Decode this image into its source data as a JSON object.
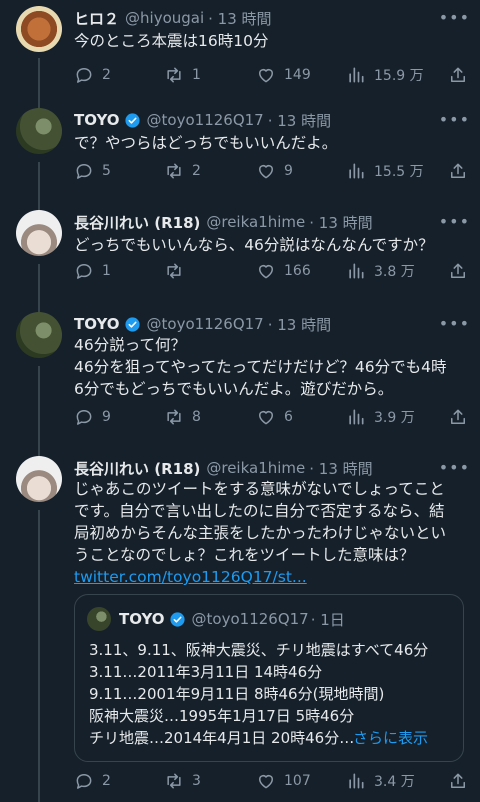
{
  "tweets": [
    {
      "name": "ヒロ２",
      "handle": "@hiyougai",
      "time": "· 13 時間",
      "text": "今のところ本震は16時10分",
      "replies": "2",
      "retweets": "1",
      "likes": "149",
      "views": "15.9 万"
    },
    {
      "name": "TOYO",
      "handle": "@toyo1126Q17",
      "time": "· 13 時間",
      "text": "で？やつらはどっちでもいいんだよ。",
      "replies": "5",
      "retweets": "2",
      "likes": "9",
      "views": "15.5 万"
    },
    {
      "name": "長谷川れい (R18)",
      "handle": "@reika1hime",
      "time": "· 13 時間",
      "text": "どっちでもいいんなら、46分説はなんなんですか？",
      "replies": "1",
      "retweets": "",
      "likes": "166",
      "views": "3.8 万"
    },
    {
      "name": "TOYO",
      "handle": "@toyo1126Q17",
      "time": "· 13 時間",
      "text": "46分説って何？\n46分を狙ってやってたってだけだけど？46分でも4時\n6分でもどっちでもいいんだよ。遊びだから。",
      "replies": "9",
      "retweets": "8",
      "likes": "6",
      "views": "3.9 万"
    },
    {
      "name": "長谷川れい (R18)",
      "handle": "@reika1hime",
      "time": "· 13 時間",
      "text": "じゃあこのツイートをする意味がないでしょってこと\nです。自分で言い出したのに自分で否定するなら、結\n局初めからそんな主張をしたかったわけじゃないとい\nうことなのでしょ？これをツイートした意味は？",
      "link": "twitter.com/toyo1126Q17/st...",
      "replies": "2",
      "retweets": "3",
      "likes": "107",
      "views": "3.4 万"
    }
  ],
  "quote": {
    "name": "TOYO",
    "handle": "@toyo1126Q17",
    "time": "· 1日",
    "text": "3.11、9.11、阪神大震災、チリ地震はすべて46分\n3.11…2011年3月11日 14時46分\n9.11…2001年9月11日 8時46分(現地時間)\n阪神大震災…1995年1月17日 5時46分\nチリ地震…2014年4月1日 20時46分…",
    "show_more": "さらに表示"
  },
  "icons": {
    "reply": "speech-bubble-icon",
    "retweet": "retweet-arrows-icon",
    "like": "heart-icon",
    "views": "bar-chart-icon",
    "share": "share-upload-icon",
    "verified": "verified-badge-icon",
    "more": "more-dots-icon"
  },
  "colors": {
    "background": "#15202b",
    "text": "#e7e9ea",
    "muted": "#8b98a5",
    "accent": "#1d9bf0",
    "border": "#38444d"
  }
}
